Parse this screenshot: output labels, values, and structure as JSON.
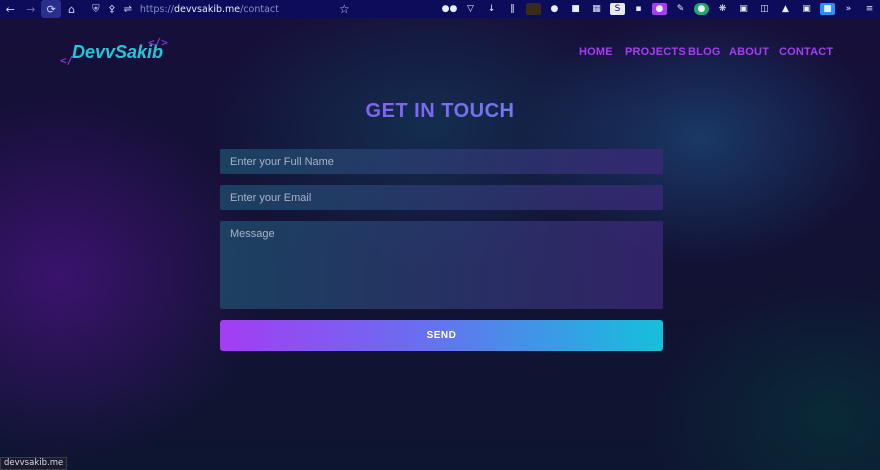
{
  "browser": {
    "url_scheme": "https://",
    "url_host": "devvsakib.me",
    "url_path": "/contact",
    "status_url": "devvsakib.me",
    "icons": {
      "back": "back-arrow-icon",
      "forward": "forward-arrow-icon",
      "reload": "reload-icon",
      "home": "home-icon",
      "shield": "shield-icon",
      "lock": "lock-icon",
      "permissions": "permissions-icon",
      "bookmark": "star-icon"
    },
    "toolbar_colors": {
      "background": "#0c0c5a",
      "icon": "#cfd3ff"
    }
  },
  "site": {
    "logo_open": "</",
    "logo_text": "DevvSakib",
    "logo_close": "</>",
    "nav": [
      "HOME",
      "PROJECTS",
      "BLOG",
      "ABOUT",
      "CONTACT"
    ],
    "accent": "#a83cf5",
    "accent2": "#22c7da"
  },
  "contact": {
    "title": "GET IN TOUCH",
    "name_placeholder": "Enter your Full Name",
    "email_placeholder": "Enter your Email",
    "message_placeholder": "Message",
    "send_label": "SEND"
  }
}
